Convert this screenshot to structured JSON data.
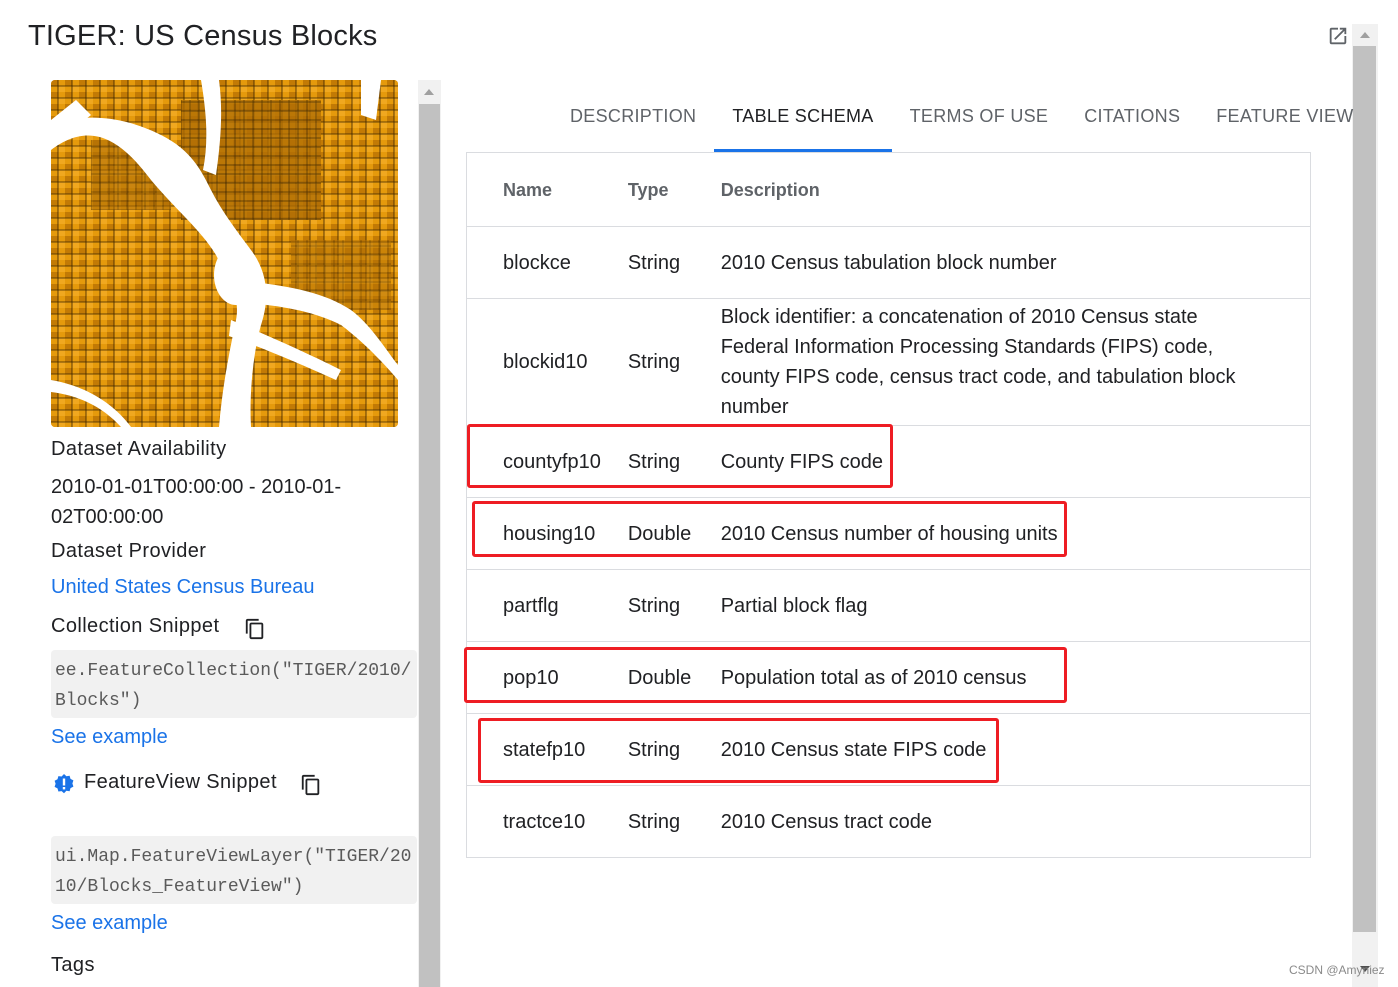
{
  "page": {
    "title": "TIGER: US Census Blocks"
  },
  "left": {
    "availability_label": "Dataset Availability",
    "availability_value": "2010-01-01T00:00:00 - 2010-01-02T00:00:00",
    "provider_label": "Dataset Provider",
    "provider_link": "United States Census Bureau",
    "collection_label": "Collection Snippet",
    "collection_code": "ee.FeatureCollection(\"TIGER/2010/Blocks\")",
    "see_example_1": "See example",
    "featureview_label": "FeatureView Snippet",
    "featureview_code": "ui.Map.FeatureViewLayer(\"TIGER/2010/Blocks_FeatureView\")",
    "see_example_2": "See example",
    "tags_label": "Tags"
  },
  "tabs": [
    {
      "label": "DESCRIPTION",
      "active": false
    },
    {
      "label": "TABLE SCHEMA",
      "active": true
    },
    {
      "label": "TERMS OF USE",
      "active": false
    },
    {
      "label": "CITATIONS",
      "active": false
    },
    {
      "label": "FEATURE VIEW",
      "active": false
    }
  ],
  "schema": {
    "headers": {
      "name": "Name",
      "type": "Type",
      "description": "Description"
    },
    "rows": [
      {
        "name": "blockce",
        "type": "String",
        "description": "2010 Census tabulation block number",
        "highlighted": false
      },
      {
        "name": "blockid10",
        "type": "String",
        "description": "Block identifier: a concatenation of 2010 Census state Federal Information Processing Standards (FIPS) code, county FIPS code, census tract code, and tabulation block number",
        "highlighted": false
      },
      {
        "name": "countyfp10",
        "type": "String",
        "description": "County FIPS code",
        "highlighted": true
      },
      {
        "name": "housing10",
        "type": "Double",
        "description": "2010 Census number of housing units",
        "highlighted": true
      },
      {
        "name": "partflg",
        "type": "String",
        "description": "Partial block flag",
        "highlighted": false
      },
      {
        "name": "pop10",
        "type": "Double",
        "description": "Population total as of 2010 census",
        "highlighted": true
      },
      {
        "name": "statefp10",
        "type": "String",
        "description": "2010 Census state FIPS code",
        "highlighted": true
      },
      {
        "name": "tractce10",
        "type": "String",
        "description": "2010 Census tract code",
        "highlighted": false
      }
    ]
  },
  "icons": {
    "open_external": "open-in-new-icon",
    "copy": "copy-icon",
    "warning": "warning-badge-icon"
  },
  "colors": {
    "accent": "#1a73e8",
    "highlight_box": "#ee1d23",
    "map_fill": "#e2930a"
  },
  "watermark": "CSDN @Amyniez"
}
